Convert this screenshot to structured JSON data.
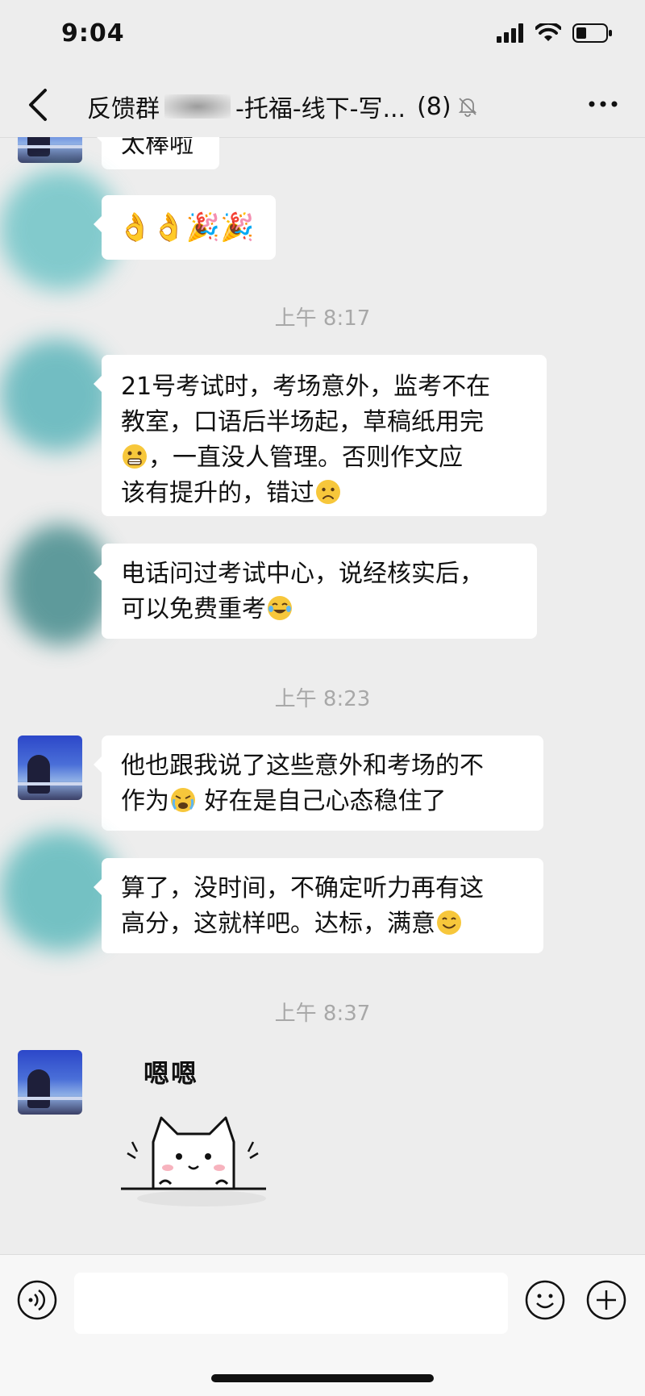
{
  "status_bar": {
    "time": "9:04",
    "icons": [
      "signal-icon",
      "wifi-icon",
      "battery-icon"
    ]
  },
  "nav": {
    "title_part1": "反馈群",
    "title_part2": "-托福-线下-写...",
    "member_count": "(8)",
    "back_icon": "chevron-left-icon",
    "mute_icon": "bell-muted-icon",
    "more_icon": "more-dots-icon"
  },
  "messages": {
    "m0_partial": "太棒啦",
    "m1_emojis": "👌👌🎉🎉",
    "ts1": "上午 8:17",
    "m2_line1": "21号考试时，考场意外，监考不在",
    "m2_line2": "教室，口语后半场起，草稿纸用完",
    "m2_line3": "，一直没人管理。否则作文应",
    "m2_line4": "该有提升的，错过",
    "m3_line1": "电话问过考试中心，说经核实后，",
    "m3_line2": "可以免费重考",
    "ts2": "上午 8:23",
    "m4_line1": "他也跟我说了这些意外和考场的不",
    "m4_line2a": "作为",
    "m4_line2b": " 好在是自己心态稳住了",
    "m5_line1": "算了，没时间，不确定听力再有这",
    "m5_line2": "高分，这就样吧。达标，满意",
    "ts3": "上午 8:37",
    "sticker_text": "嗯嗯"
  },
  "input": {
    "value": "",
    "placeholder": ""
  },
  "colors": {
    "background": "#ededed",
    "bubble": "#ffffff",
    "timestamp": "#a8a8a8",
    "smudge_teal": "#4fb3b8"
  }
}
